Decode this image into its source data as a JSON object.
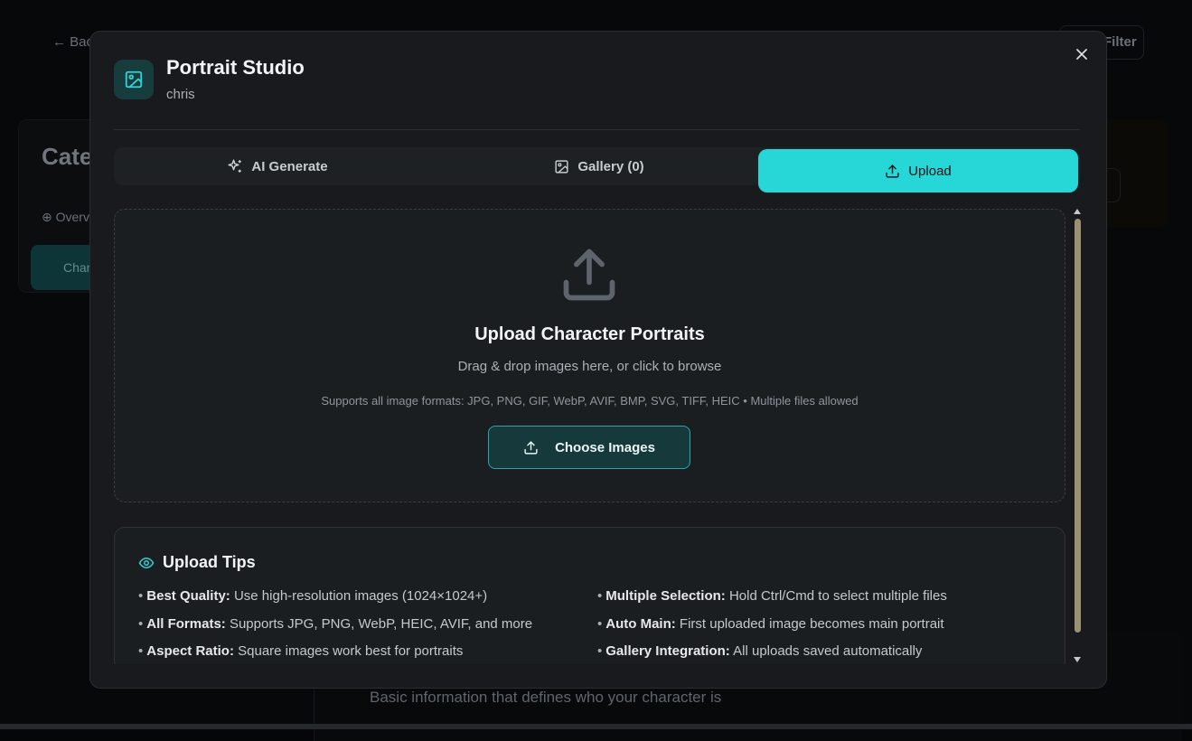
{
  "background": {
    "back_label": "← Back",
    "filter_label": "Filter",
    "categories_title": "Categories",
    "overview_label": "Overview",
    "characters_label": "Characters",
    "description": "Basic information that defines who your character is"
  },
  "modal": {
    "title": "Portrait Studio",
    "subtitle": "chris",
    "close_icon": "close-icon",
    "tabs": [
      {
        "label": "AI Generate",
        "icon": "sparkles-icon",
        "active": false
      },
      {
        "label": "Gallery (0)",
        "icon": "image-icon",
        "active": false
      },
      {
        "label": "Upload",
        "icon": "upload-icon",
        "active": true
      }
    ],
    "dropzone": {
      "title": "Upload Character Portraits",
      "subtitle": "Drag & drop images here, or click to browse",
      "formats": "Supports all image formats: JPG, PNG, GIF, WebP, AVIF, BMP, SVG, TIFF, HEIC • Multiple files allowed",
      "button_label": "Choose Images"
    },
    "tips": {
      "title": "Upload Tips",
      "left": [
        {
          "bullet": "•",
          "label": "Best Quality:",
          "text": "Use high-resolution images (1024×1024+)"
        },
        {
          "bullet": "•",
          "label": "All Formats:",
          "text": "Supports JPG, PNG, WebP, HEIC, AVIF, and more"
        },
        {
          "bullet": "•",
          "label": "Aspect Ratio:",
          "text": "Square images work best for portraits"
        }
      ],
      "right": [
        {
          "bullet": "•",
          "label": "Multiple Selection:",
          "text": "Hold Ctrl/Cmd to select multiple files"
        },
        {
          "bullet": "•",
          "label": "Auto Main:",
          "text": "First uploaded image becomes main portrait"
        },
        {
          "bullet": "•",
          "label": "Gallery Integration:",
          "text": "All uploads saved automatically"
        }
      ]
    }
  },
  "colors": {
    "accent": "#27d6d7",
    "modal_bg": "#181a1d",
    "page_bg": "#050607"
  }
}
